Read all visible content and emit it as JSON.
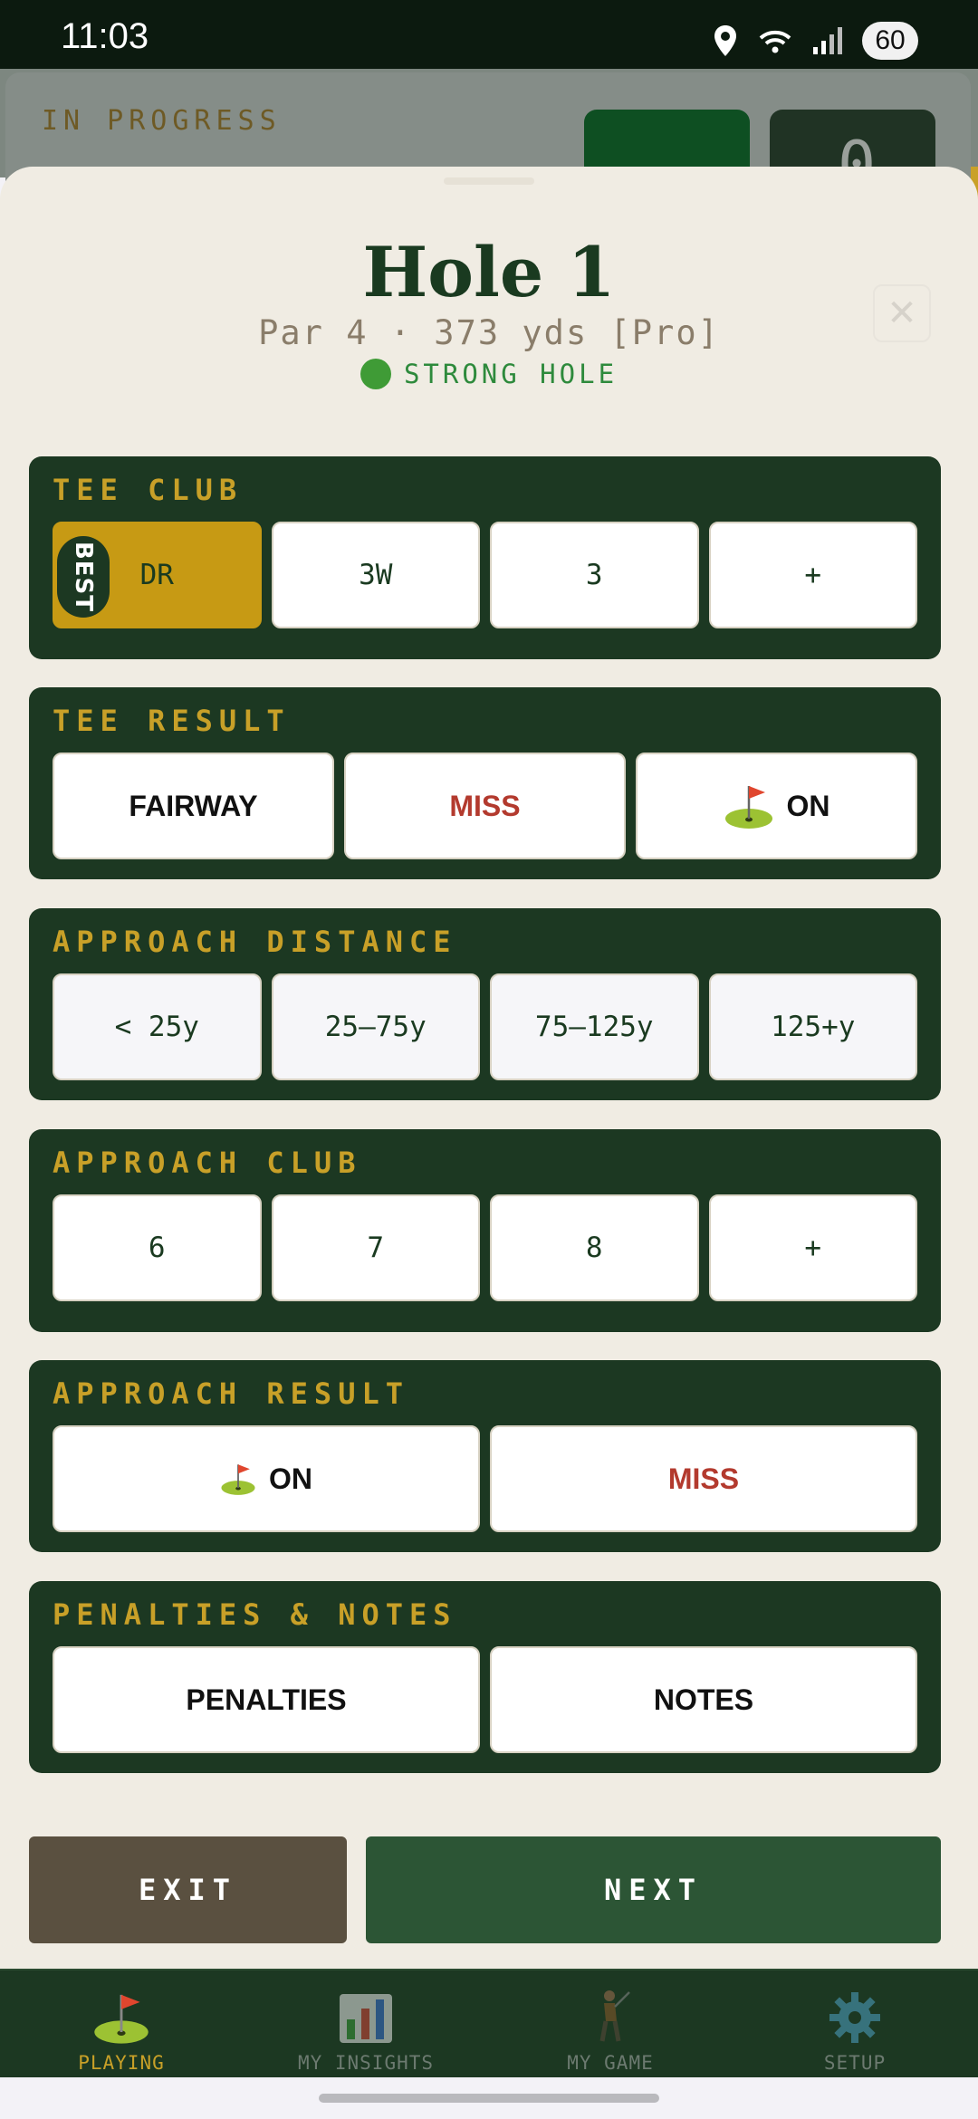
{
  "status_bar": {
    "time": "11:03",
    "battery": "60"
  },
  "background_screen": {
    "label": "IN PROGRESS",
    "score": "0"
  },
  "header": {
    "title": "Hole 1",
    "subtitle": "Par 4 · 373 yds [Pro]",
    "status": "STRONG HOLE",
    "close_symbol": "✕"
  },
  "sections": {
    "tee_club": {
      "label": "TEE CLUB",
      "best_badge": "BEST",
      "options": [
        "DR",
        "3W",
        "3",
        "+"
      ],
      "selected": "DR"
    },
    "tee_result": {
      "label": "TEE RESULT",
      "options": [
        "FAIRWAY",
        "MISS",
        "ON"
      ]
    },
    "approach_distance": {
      "label": "APPROACH DISTANCE",
      "options": [
        "< 25y",
        "25–75y",
        "75–125y",
        "125+y"
      ]
    },
    "approach_club": {
      "label": "APPROACH CLUB",
      "options": [
        "6",
        "7",
        "8",
        "+"
      ]
    },
    "approach_result": {
      "label": "APPROACH RESULT",
      "options": [
        "ON",
        "MISS"
      ]
    },
    "penalties_notes": {
      "label": "PENALTIES & NOTES",
      "options": [
        "PENALTIES",
        "NOTES"
      ]
    }
  },
  "actions": {
    "exit": "EXIT",
    "next": "NEXT"
  },
  "nav": {
    "items": [
      {
        "label": "PLAYING",
        "icon": "golf-flag-icon"
      },
      {
        "label": "MY INSIGHTS",
        "icon": "bar-chart-icon"
      },
      {
        "label": "MY GAME",
        "icon": "golfer-icon"
      },
      {
        "label": "SETUP",
        "icon": "gear-icon"
      }
    ],
    "active": "PLAYING"
  },
  "colors": {
    "section_bg": "#1c3822",
    "accent_gold": "#c79a14",
    "miss_red": "#b33a2e",
    "status_green": "#2e8a3c"
  }
}
